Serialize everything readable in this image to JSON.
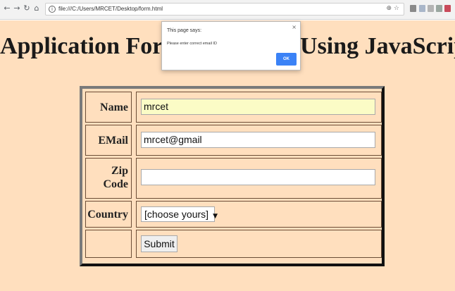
{
  "browser": {
    "back_glyph": "←",
    "forward_glyph": "→",
    "reload_glyph": "↻",
    "home_glyph": "⌂",
    "info_glyph": "i",
    "url": "file:///C:/Users/MRCET/Desktop/form.html",
    "omnibox_icons": "⊕ ☆"
  },
  "page": {
    "title": "Application Form Validation Using JavaScript",
    "background": "#ffdfbe"
  },
  "form": {
    "name_label": "Name",
    "name_value": "mrcet",
    "email_label": "EMail",
    "email_value": "mrcet@gmail",
    "zip_label_line1": "Zip",
    "zip_label_line2": "Code",
    "zip_value": "",
    "country_label": "Country",
    "country_selected": "[choose yours]",
    "country_arrow": "▼",
    "submit_label": "Submit"
  },
  "alert": {
    "title": "This page says:",
    "message": "Please enter correct email ID",
    "close_glyph": "×",
    "ok_label": "OK",
    "ok_color": "#3b82f6"
  }
}
